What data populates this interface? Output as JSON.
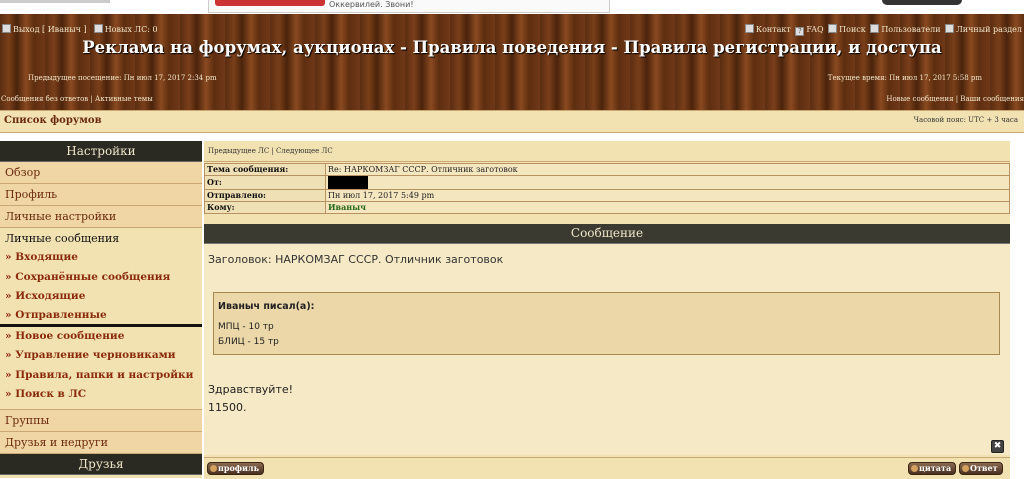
{
  "ad": {
    "text": "Оккервилей. Звони!"
  },
  "nav": {
    "logout": "Выход [ Иваныч ]",
    "new_pm": "Новых ЛС: 0",
    "contact": "Контакт",
    "faq": "FAQ",
    "search": "Поиск",
    "users": "Пользователи",
    "personal": "Личный раздел"
  },
  "site": {
    "title": "Реклама на форумах, аукционах - Правила поведения - Правила регистрации, и доступа"
  },
  "visits": {
    "previous": "Предыдущее посещение: Пн июл 17, 2017 2:34 pm",
    "current": "Текущее время: Пн июл 17, 2017 5:58 pm"
  },
  "links": {
    "left": "Сообщения без ответов  |  Активные темы",
    "right": "Новые сообщения  |  Ваши сообщения"
  },
  "forumbar": {
    "left": "Список форумов",
    "timezone": "Часовой пояс: UTC + 3 часа"
  },
  "sidebar": {
    "header": "Настройки",
    "overview": "Обзор",
    "profile": "Профиль",
    "prefs": "Личные настройки",
    "pm_section": "Личные сообщения",
    "inbox": "» Входящие",
    "saved": "» Сохранённые сообщения",
    "outbox": "» Исходящие",
    "sent": "» Отправленные",
    "new_msg": "» Новое сообщение",
    "drafts": "» Управление черновиками",
    "rules": "» Правила, папки и настройки",
    "search_pm": "» Поиск в ЛС",
    "groups": "Группы",
    "friends_foes": "Друзья и недруги",
    "friends_header": "Друзья"
  },
  "main": {
    "prevnext": "Предыдущее ЛС  |  Следующее ЛС",
    "fields": {
      "subject_label": "Тема сообщения:",
      "subject_value": "Re: НАРКОМЗАГ СССР. Отличник заготовок",
      "from_label": "От:",
      "sent_label": "Отправлено:",
      "sent_value": "Пн июл 17, 2017 5:49 pm",
      "to_label": "Кому:",
      "to_value": "Иваныч"
    },
    "message_header": "Сообщение",
    "subject_line": "Заголовок: НАРКОМЗАГ СССР. Отличник заготовок",
    "quote": {
      "author": "Иваныч писал(а):",
      "line1": "МПЦ - 10 тр",
      "line2": "БЛИЦ - 15 тр"
    },
    "greeting": "Здравствуйте!",
    "price": "11500.",
    "profile_btn": "профиль",
    "quote_btn": "цитата",
    "reply_btn": "Ответ",
    "close_btn": "✖"
  }
}
